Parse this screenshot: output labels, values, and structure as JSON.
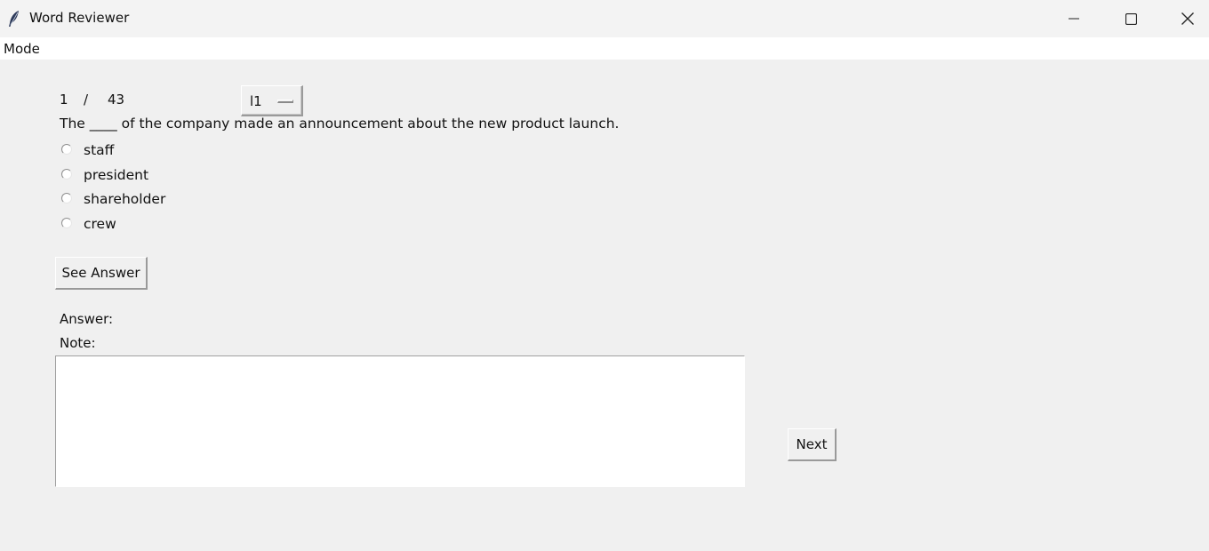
{
  "window": {
    "title": "Word Reviewer",
    "icon": "feather-icon",
    "controls": [
      "minimize-icon",
      "maximize-icon",
      "close-icon"
    ]
  },
  "menubar": {
    "mode_label": "Mode"
  },
  "counter": {
    "current": "1",
    "separator": "/",
    "total": "43"
  },
  "set_selector": {
    "selected": "l1"
  },
  "question": {
    "text": "The ____ of the company made an announcement about the new product launch."
  },
  "options": [
    {
      "label": "staff",
      "checked": false
    },
    {
      "label": "president",
      "checked": false
    },
    {
      "label": "shareholder",
      "checked": false
    },
    {
      "label": "crew",
      "checked": false
    }
  ],
  "buttons": {
    "see_answer": "See Answer",
    "next": "Next"
  },
  "answer": {
    "label": "Answer:",
    "value": ""
  },
  "note": {
    "label": "Note:",
    "value": ""
  },
  "colors": {
    "window_bg": "#f0f0f0",
    "titlebar_bg": "#f3f3f3",
    "menubar_bg": "#ffffff",
    "text": "#111111",
    "icon_accent": "#2d3a5a"
  }
}
